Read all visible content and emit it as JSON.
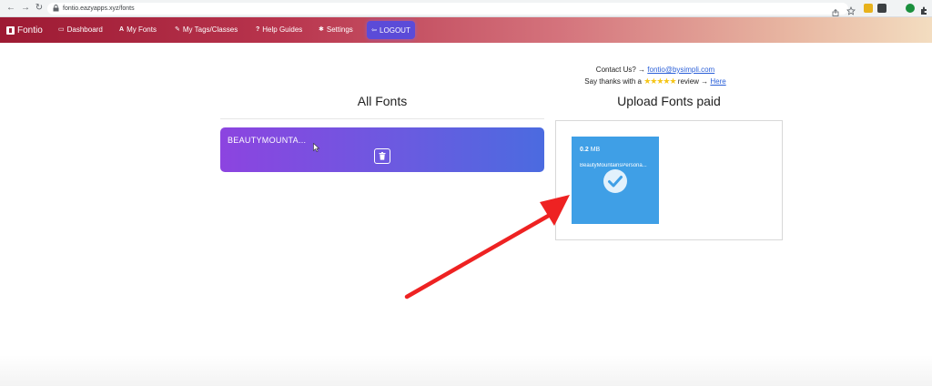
{
  "browser": {
    "url": "fontio.eazyapps.xyz/fonts",
    "nav_icons": [
      "back-icon",
      "forward-icon",
      "reload-icon"
    ]
  },
  "navbar": {
    "brand": "Fontio",
    "items": [
      {
        "label": "Dashboard",
        "icon": "dashboard-icon"
      },
      {
        "label": "My Fonts",
        "icon": "font-icon"
      },
      {
        "label": "My Tags/Classes",
        "icon": "tag-icon"
      },
      {
        "label": "Help Guides",
        "icon": "question-icon"
      },
      {
        "label": "Settings",
        "icon": "gear-icon"
      }
    ],
    "logout": "LOGOUT"
  },
  "contact": {
    "prefix": "Contact Us? →",
    "email": "fontio@bysimpli.com",
    "thanks_prefix": "Say thanks with a",
    "stars": "★★★★★",
    "thanks_suffix": "review →",
    "here": "Here"
  },
  "all_fonts": {
    "heading": "All Fonts",
    "items": [
      {
        "name": "BEAUTYMOUNTA..."
      }
    ]
  },
  "upload": {
    "heading": "Upload Fonts paid",
    "file": {
      "size_value": "0.2",
      "size_unit": "MB",
      "name": "BeautyMountainsPersona..."
    }
  },
  "colors": {
    "navbar_start": "#9d1a33",
    "navbar_end": "#f3ddc0",
    "card_start": "#8c44e0",
    "card_end": "#4b6be0",
    "tile": "#3f9fe6",
    "arrow": "#ee2222"
  }
}
